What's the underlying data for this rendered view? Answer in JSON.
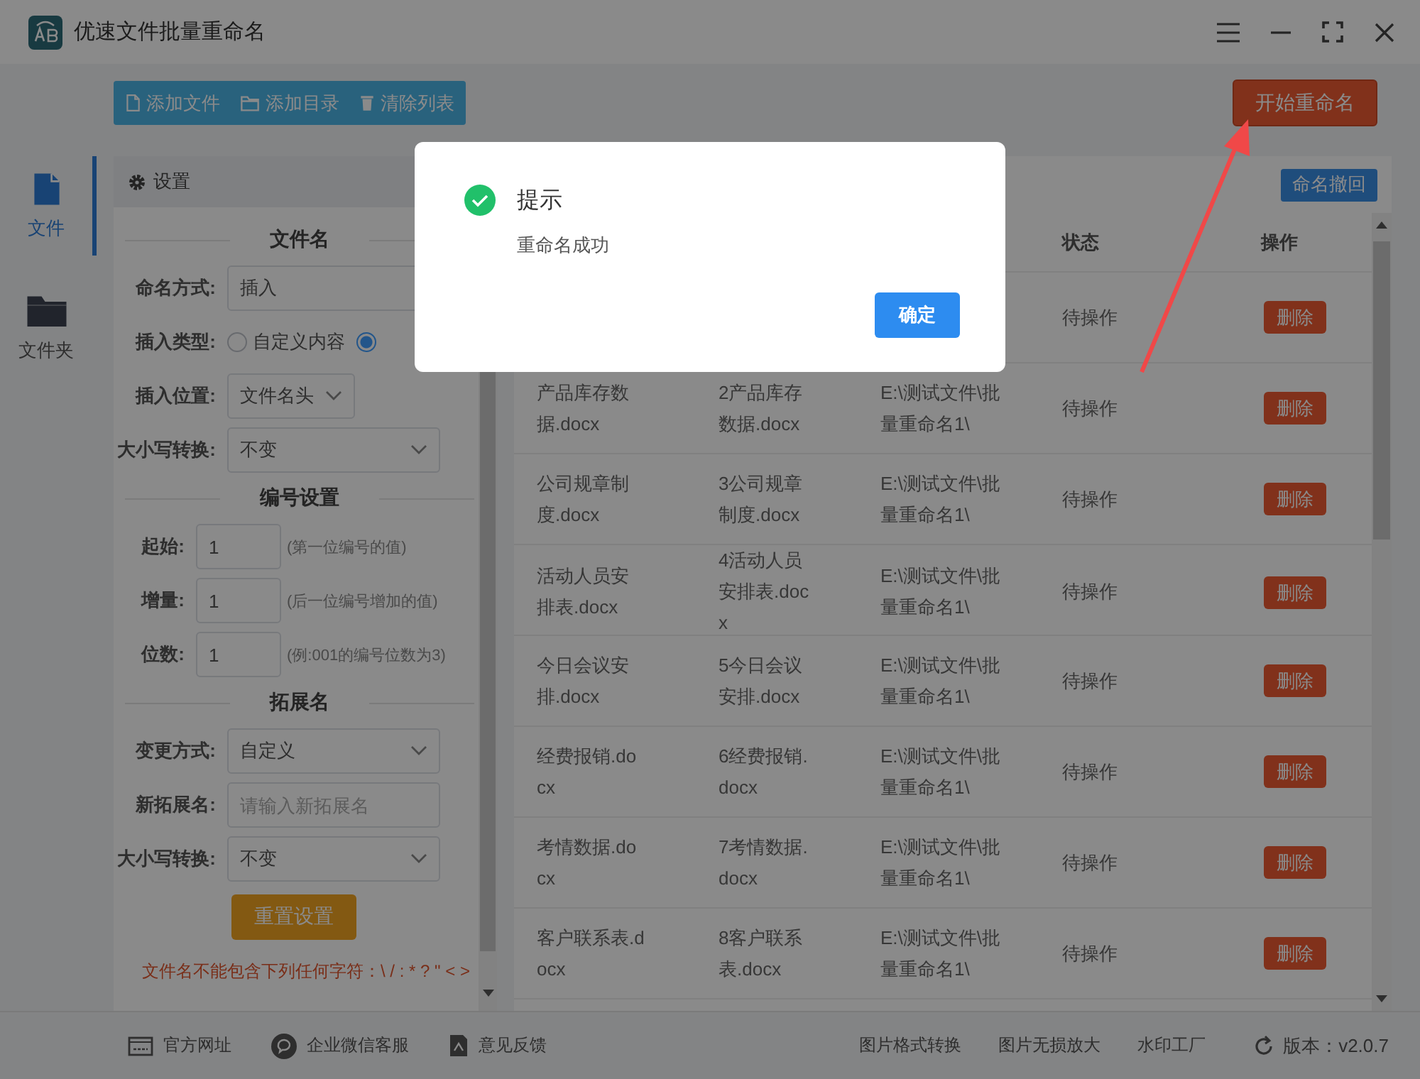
{
  "window": {
    "title": "优速文件批量重命名"
  },
  "toolbar": {
    "buttons": [
      {
        "label": "添加文件",
        "kind": "file"
      },
      {
        "label": "添加目录",
        "kind": "folder"
      },
      {
        "label": "清除列表",
        "kind": "trash"
      }
    ],
    "start_button": "开始重命名"
  },
  "nav": [
    {
      "label": "文件",
      "kind": "file",
      "selected": true
    },
    {
      "label": "文件夹",
      "kind": "folder",
      "selected": false
    }
  ],
  "settings": {
    "title": "设置",
    "sections": [
      {
        "title": "文件名",
        "rows": [
          {
            "kind": "text",
            "label": "命名方式:",
            "value": "插入"
          },
          {
            "kind": "radio",
            "label": "插入类型:",
            "options": [
              {
                "label": "自定义内容",
                "selected": false
              },
              {
                "selected": true
              }
            ]
          },
          {
            "kind": "compact",
            "label": "插入位置:",
            "value": "文件名头"
          },
          {
            "kind": "select",
            "label": "大小写转换:",
            "value": "不变"
          }
        ]
      },
      {
        "title": "编号设置",
        "rows": [
          {
            "kind": "number",
            "label": "起始:",
            "value": "1",
            "hint": "(第一位编号的值)"
          },
          {
            "kind": "number",
            "label": "增量:",
            "value": "1",
            "hint": "(后一位编号增加的值)"
          },
          {
            "kind": "number",
            "label": "位数:",
            "value": "1",
            "hint": "(例:001的编号位数为3)"
          }
        ]
      },
      {
        "title": "拓展名",
        "rows": [
          {
            "kind": "select",
            "label": "变更方式:",
            "value": "自定义"
          },
          {
            "kind": "text",
            "label": "新拓展名:",
            "placeholder": "请输入新拓展名"
          },
          {
            "kind": "select",
            "label": "大小写转换:",
            "value": "不变"
          }
        ]
      }
    ],
    "reset_button": "重置设置",
    "warning": "文件名不能包含下列任何字符：\\ / : * ? \" < >"
  },
  "file_table": {
    "undo_button": "命名撤回",
    "columns": {
      "status": "状态",
      "action": "操作"
    },
    "rows": [
      {
        "status": "待操作",
        "action": "删除"
      },
      {
        "original_name": "产品库存数据.docx",
        "new_name": "2产品库存数据.docx",
        "path": "E:\\测试文件\\批量重命名1\\",
        "status": "待操作",
        "action": "删除"
      },
      {
        "original_name": "公司规章制度.docx",
        "new_name": "3公司规章制度.docx",
        "path": "E:\\测试文件\\批量重命名1\\",
        "status": "待操作",
        "action": "删除"
      },
      {
        "original_name": "活动人员安排表.docx",
        "new_name": "4活动人员安排表.docx",
        "path": "E:\\测试文件\\批量重命名1\\",
        "status": "待操作",
        "action": "删除"
      },
      {
        "original_name": "今日会议安排.docx",
        "new_name": "5今日会议安排.docx",
        "path": "E:\\测试文件\\批量重命名1\\",
        "status": "待操作",
        "action": "删除"
      },
      {
        "original_name": "经费报销.docx",
        "new_name": "6经费报销.docx",
        "path": "E:\\测试文件\\批量重命名1\\",
        "status": "待操作",
        "action": "删除"
      },
      {
        "original_name": "考情数据.docx",
        "new_name": "7考情数据.docx",
        "path": "E:\\测试文件\\批量重命名1\\",
        "status": "待操作",
        "action": "删除"
      },
      {
        "original_name": "客户联系表.docx",
        "new_name": "8客户联系表.docx",
        "path": "E:\\测试文件\\批量重命名1\\",
        "status": "待操作",
        "action": "删除"
      }
    ]
  },
  "footer": {
    "links": [
      {
        "label": "官方网址",
        "kind": "web"
      },
      {
        "label": "企业微信客服",
        "kind": "chat"
      },
      {
        "label": "意见反馈",
        "kind": "feedback"
      }
    ],
    "tools": [
      "图片格式转换",
      "图片无损放大",
      "水印工厂"
    ],
    "version": "版本：v2.0.7"
  },
  "dialog": {
    "title": "提示",
    "message": "重命名成功",
    "button": "确定"
  }
}
